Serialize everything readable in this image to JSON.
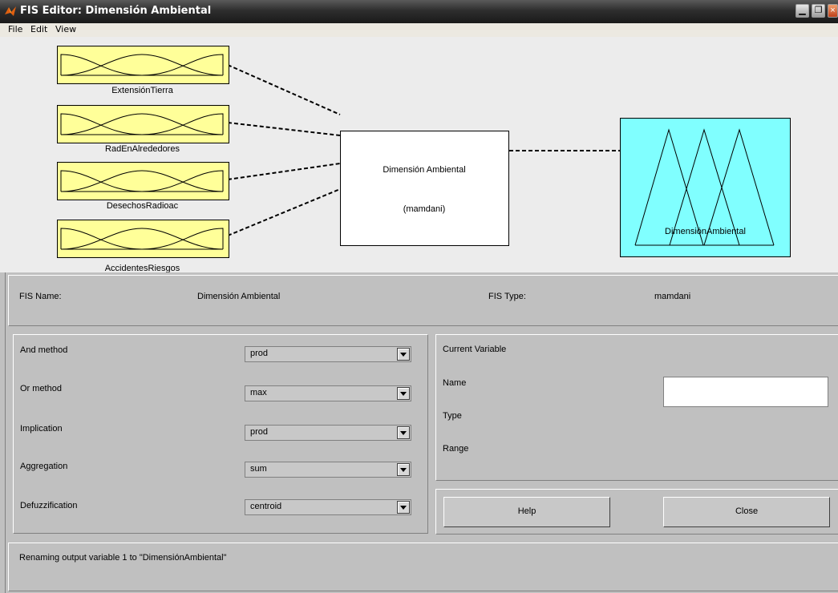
{
  "window": {
    "title": "FIS Editor: Dimensión Ambiental",
    "controls": [
      "minimize",
      "restore",
      "close"
    ]
  },
  "menu": [
    "File",
    "Edit",
    "View"
  ],
  "diagram": {
    "inputs": [
      "ExtensiónTierra",
      "RadEnAlrededores",
      "DesechosRadioac",
      "AccidentesRiesgos"
    ],
    "system_name": "Dimensión Ambiental",
    "system_type": "(mamdani)",
    "output": "DimensiónAmbiental",
    "colors": {
      "input_box": "#ffff99",
      "output_box": "#80ffff",
      "system_box": "#ffffff"
    }
  },
  "fis_info": {
    "name_label": "FIS Name:",
    "name_value": "Dimensión Ambiental",
    "type_label": "FIS Type:",
    "type_value": "mamdani"
  },
  "methods": [
    {
      "label": "And method",
      "value": "prod"
    },
    {
      "label": "Or method",
      "value": "max"
    },
    {
      "label": "Implication",
      "value": "prod"
    },
    {
      "label": "Aggregation",
      "value": "sum"
    },
    {
      "label": "Defuzzification",
      "value": "centroid"
    }
  ],
  "current_variable": {
    "title": "Current Variable",
    "name_label": "Name",
    "name_value": "",
    "type_label": "Type",
    "range_label": "Range"
  },
  "buttons": {
    "help": "Help",
    "close": "Close"
  },
  "status": "Renaming output variable 1 to \"DimensiónAmbiental\""
}
